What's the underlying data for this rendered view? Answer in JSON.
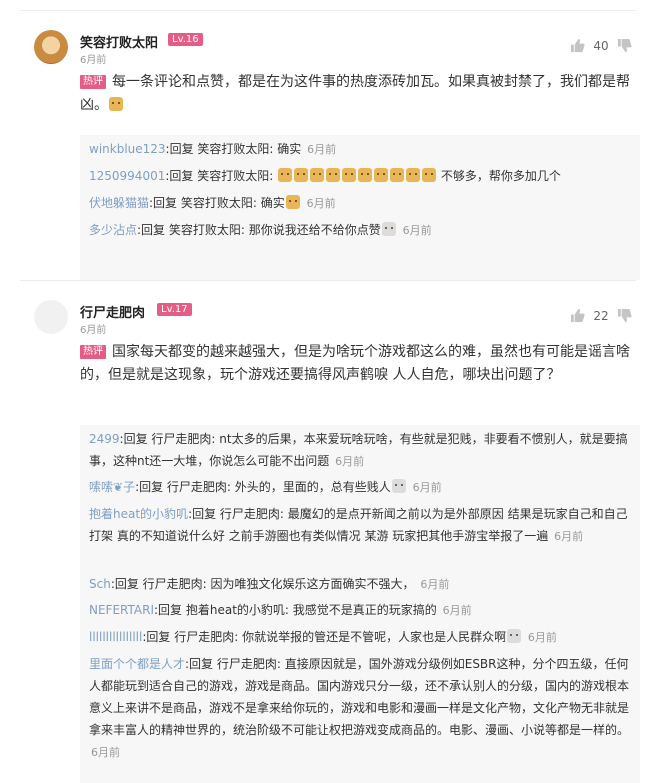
{
  "comments": [
    {
      "author": "笑容打败太阳",
      "level": "Lv.16",
      "time": "6月前",
      "likes": "40",
      "hot_tag": "热评",
      "text": "每一条评论和点赞，都是在为这件事的热度添砖加瓦。如果真被封禁了，我们都是帮凶。",
      "replies": [
        {
          "name": "winkblue123",
          "prefix": ":回复 笑容打败太阳: ",
          "text": "确实",
          "time": "6月前"
        },
        {
          "name": "1250994001",
          "prefix": ":回复 笑容打败太阳: ",
          "text": " 不够多，帮你多加几个",
          "time": "6月前"
        },
        {
          "name": "伏地躲猫猫",
          "prefix": ":回复 笑容打败太阳: ",
          "text": "确实",
          "time": "6月前"
        },
        {
          "name": "多少沾点",
          "prefix": ":回复 笑容打败太阳: ",
          "text": "那你说我还给不给你点赞",
          "time": "6月前"
        }
      ]
    },
    {
      "author": "行尸走肥肉",
      "level": "Lv.17",
      "time": "6月前",
      "likes": "22",
      "hot_tag": "热评",
      "text": "国家每天都变的越来越强大，但是为啥玩个游戏都这么的难，虽然也有可能是谣言啥的，但是就是这现象，玩个游戏还要搞得风声鹤唳 人人自危，哪块出问题了？",
      "replies": [
        {
          "name": "2499",
          "prefix": ":回复 行尸走肥肉: ",
          "text": "nt太多的后果，本来爱玩啥玩啥，有些就是犯贱，非要看不惯别人，就是要搞事，这种nt还一大堆，你说怎么可能不出问题",
          "time": "6月前"
        },
        {
          "name": "嗦嗦❦子",
          "prefix": ":回复 行尸走肥肉: ",
          "text": "外头的，里面的，总有些贱人",
          "time": "6月前"
        },
        {
          "name": "抱着heat的小豹叽",
          "prefix": ":回复 行尸走肥肉: ",
          "text": "最魔幻的是点开新闻之前以为是外部原因 结果是玩家自己和自己打架 真的不知道说什么好 之前手游圈也有类似情况 某游 玩家把其他手游宝举报了一遍",
          "time": "6月前"
        },
        {
          "name": "Sch",
          "prefix": ":回复 行尸走肥肉: ",
          "text": "因为唯独文化娱乐这方面确实不强大，",
          "time": "6月前"
        },
        {
          "name": "NEFERTARI",
          "prefix": ":回复 抱着heat的小豹叽: ",
          "text": "我感觉不是真正的玩家搞的",
          "time": "6月前"
        },
        {
          "name": "llllllllllllllll",
          "prefix": ":回复 行尸走肥肉: ",
          "text": "你就说举报的管还是不管呢，人家也是人民群众啊",
          "time": "6月前"
        },
        {
          "name": "里面个个都是人才",
          "prefix": ":回复 行尸走肥肉: ",
          "text": "直接原因就是，国外游戏分级例如ESBR这种，分个四五级，任何人都能玩到适合自己的游戏，游戏是商品。国内游戏只分一级，还不承认别人的分级，国内的游戏根本意义上来讲不是商品，游戏不是拿来给你玩的，游戏和电影和漫画一样是文化产物，文化产物无非就是拿来丰富人的精神世界的，统治阶级不可能让权把游戏变成商品的。电影、漫画、小说等都是一样的。",
          "time": "6月前"
        }
      ]
    }
  ],
  "colors": {
    "level_badge": "#e55d87",
    "reply_name": "#7e9fc4",
    "reply_bg": "#f7f7f7"
  },
  "icons": {
    "like": "thumb-up-icon",
    "dislike": "thumb-down-icon",
    "emoji": "cat-emoji-icon"
  }
}
